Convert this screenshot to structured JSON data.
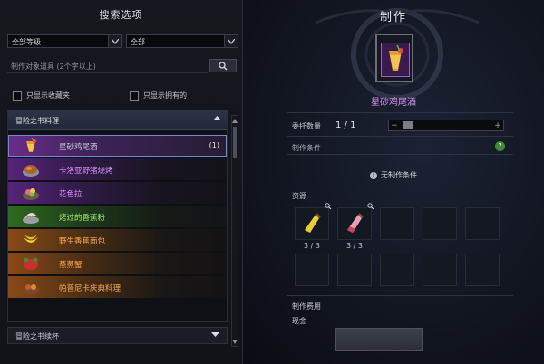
{
  "left": {
    "title": "搜索选项",
    "grade_select": "全部等级",
    "type_select": "全部",
    "search_placeholder": "制作对象道具 (2个字以上)",
    "check_favorites": "只显示收藏夹",
    "check_owned": "只显示拥有的",
    "category_open": "冒险之书料理",
    "items": [
      {
        "name": "星砂鸡尾酒",
        "count": "(1)",
        "grade": "purple",
        "icon": "cocktail-icon"
      },
      {
        "name": "卡洛亚野猪烧烤",
        "grade": "purple",
        "icon": "roast-boar-icon"
      },
      {
        "name": "花色拉",
        "grade": "purple",
        "icon": "flower-salad-icon"
      },
      {
        "name": "烤过的香蕉粉",
        "grade": "green",
        "icon": "banana-powder-icon"
      },
      {
        "name": "野生香蕉面包",
        "grade": "orange",
        "icon": "banana-bread-icon"
      },
      {
        "name": "蒸蒸蟹",
        "grade": "orange",
        "icon": "steamed-crab-icon"
      },
      {
        "name": "帕普尼卡庆典料理",
        "grade": "orange",
        "icon": "feast-dish-icon"
      }
    ],
    "category_closed": "冒险之书续杯"
  },
  "right": {
    "title": "制作",
    "item_name": "星砂鸡尾酒",
    "quantity_label": "委托数量",
    "quantity_value": "1 / 1",
    "conditions_label": "制作条件",
    "no_conditions": "无制作条件",
    "resources_label": "资源",
    "resources": [
      {
        "icon": "yellow-bottle-icon",
        "count": "3 / 3"
      },
      {
        "icon": "pink-bottle-icon",
        "count": "3 / 3"
      }
    ],
    "fee_label": "制作费用",
    "cash_label": "现金"
  },
  "colors": {
    "epic": "#d993ff",
    "uncommon": "#a8ea7a",
    "legendary": "#f3a957",
    "selection_outline": "#6f8bd8"
  }
}
